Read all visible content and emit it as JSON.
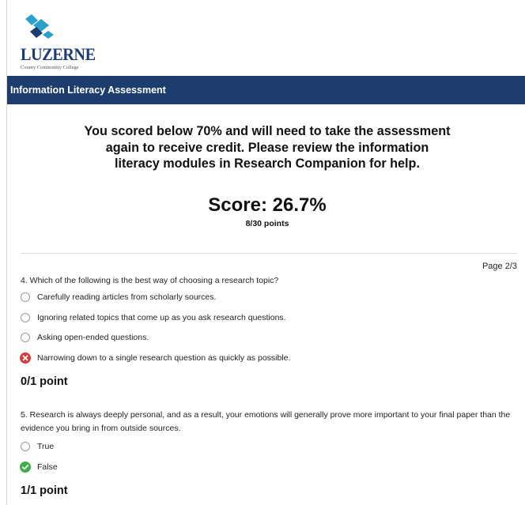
{
  "logo": {
    "name": "LUZERNE",
    "subtitle": "County Community College"
  },
  "header": {
    "title": "Information Literacy Assessment"
  },
  "result": {
    "message": "You scored below 70% and will need to take the assessment again to receive credit. Please review the information literacy modules in Research Companion for help.",
    "score": "Score: 26.7%",
    "points": "8/30 points"
  },
  "pagination": {
    "label": "Page 2/3"
  },
  "questions": [
    {
      "text": "4. Which of the following is the best way of choosing a research topic?",
      "options": [
        {
          "label": "Carefully reading articles from scholarly sources.",
          "state": "unselected"
        },
        {
          "label": "Ignoring related topics that come up as you ask research questions.",
          "state": "unselected"
        },
        {
          "label": "Asking open-ended questions.",
          "state": "unselected"
        },
        {
          "label": "Narrowing down to a single research question as quickly as possible.",
          "state": "incorrect"
        }
      ],
      "score": "0/1 point"
    },
    {
      "text": "5. Research is always deeply personal, and as a result, your emotions will generally prove more important to your final paper than the evidence you bring in from outside sources.",
      "options": [
        {
          "label": "True",
          "state": "unselected"
        },
        {
          "label": "False",
          "state": "correct"
        }
      ],
      "score": "1/1 point"
    }
  ],
  "colors": {
    "header_bg": "#1c3d6e",
    "logo_accent": "#2ba0c8",
    "logo_text": "#1d3d72",
    "incorrect": "#d93b3b",
    "correct": "#3fae49"
  },
  "icons": {
    "incorrect": "x-circle-icon",
    "correct": "check-circle-icon",
    "unselected": "radio-empty-icon"
  }
}
